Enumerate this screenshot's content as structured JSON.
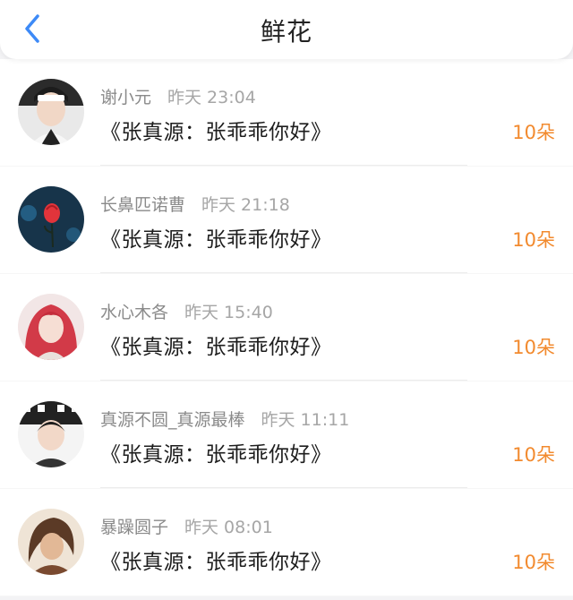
{
  "header": {
    "title": "鲜花",
    "back_icon": "chevron-left-icon",
    "accent_color": "#3d8af7"
  },
  "items": [
    {
      "user": "谢小元",
      "time": "昨天 23:04",
      "book": "《张真源：张乖乖你好》",
      "count": "10朵"
    },
    {
      "user": "长鼻匹诺曹",
      "time": "昨天 21:18",
      "book": "《张真源：张乖乖你好》",
      "count": "10朵"
    },
    {
      "user": "水心木各",
      "time": "昨天 15:40",
      "book": "《张真源：张乖乖你好》",
      "count": "10朵"
    },
    {
      "user": "真源不圆_真源最棒",
      "time": "昨天 11:11",
      "book": "《张真源：张乖乖你好》",
      "count": "10朵"
    },
    {
      "user": "暴躁圆子",
      "time": "昨天 08:01",
      "book": "《张真源：张乖乖你好》",
      "count": "10朵"
    }
  ],
  "colors": {
    "count": "#f28a2e",
    "username": "#8a8a8a",
    "time": "#a6a6a6",
    "text": "#1d1d1d"
  }
}
